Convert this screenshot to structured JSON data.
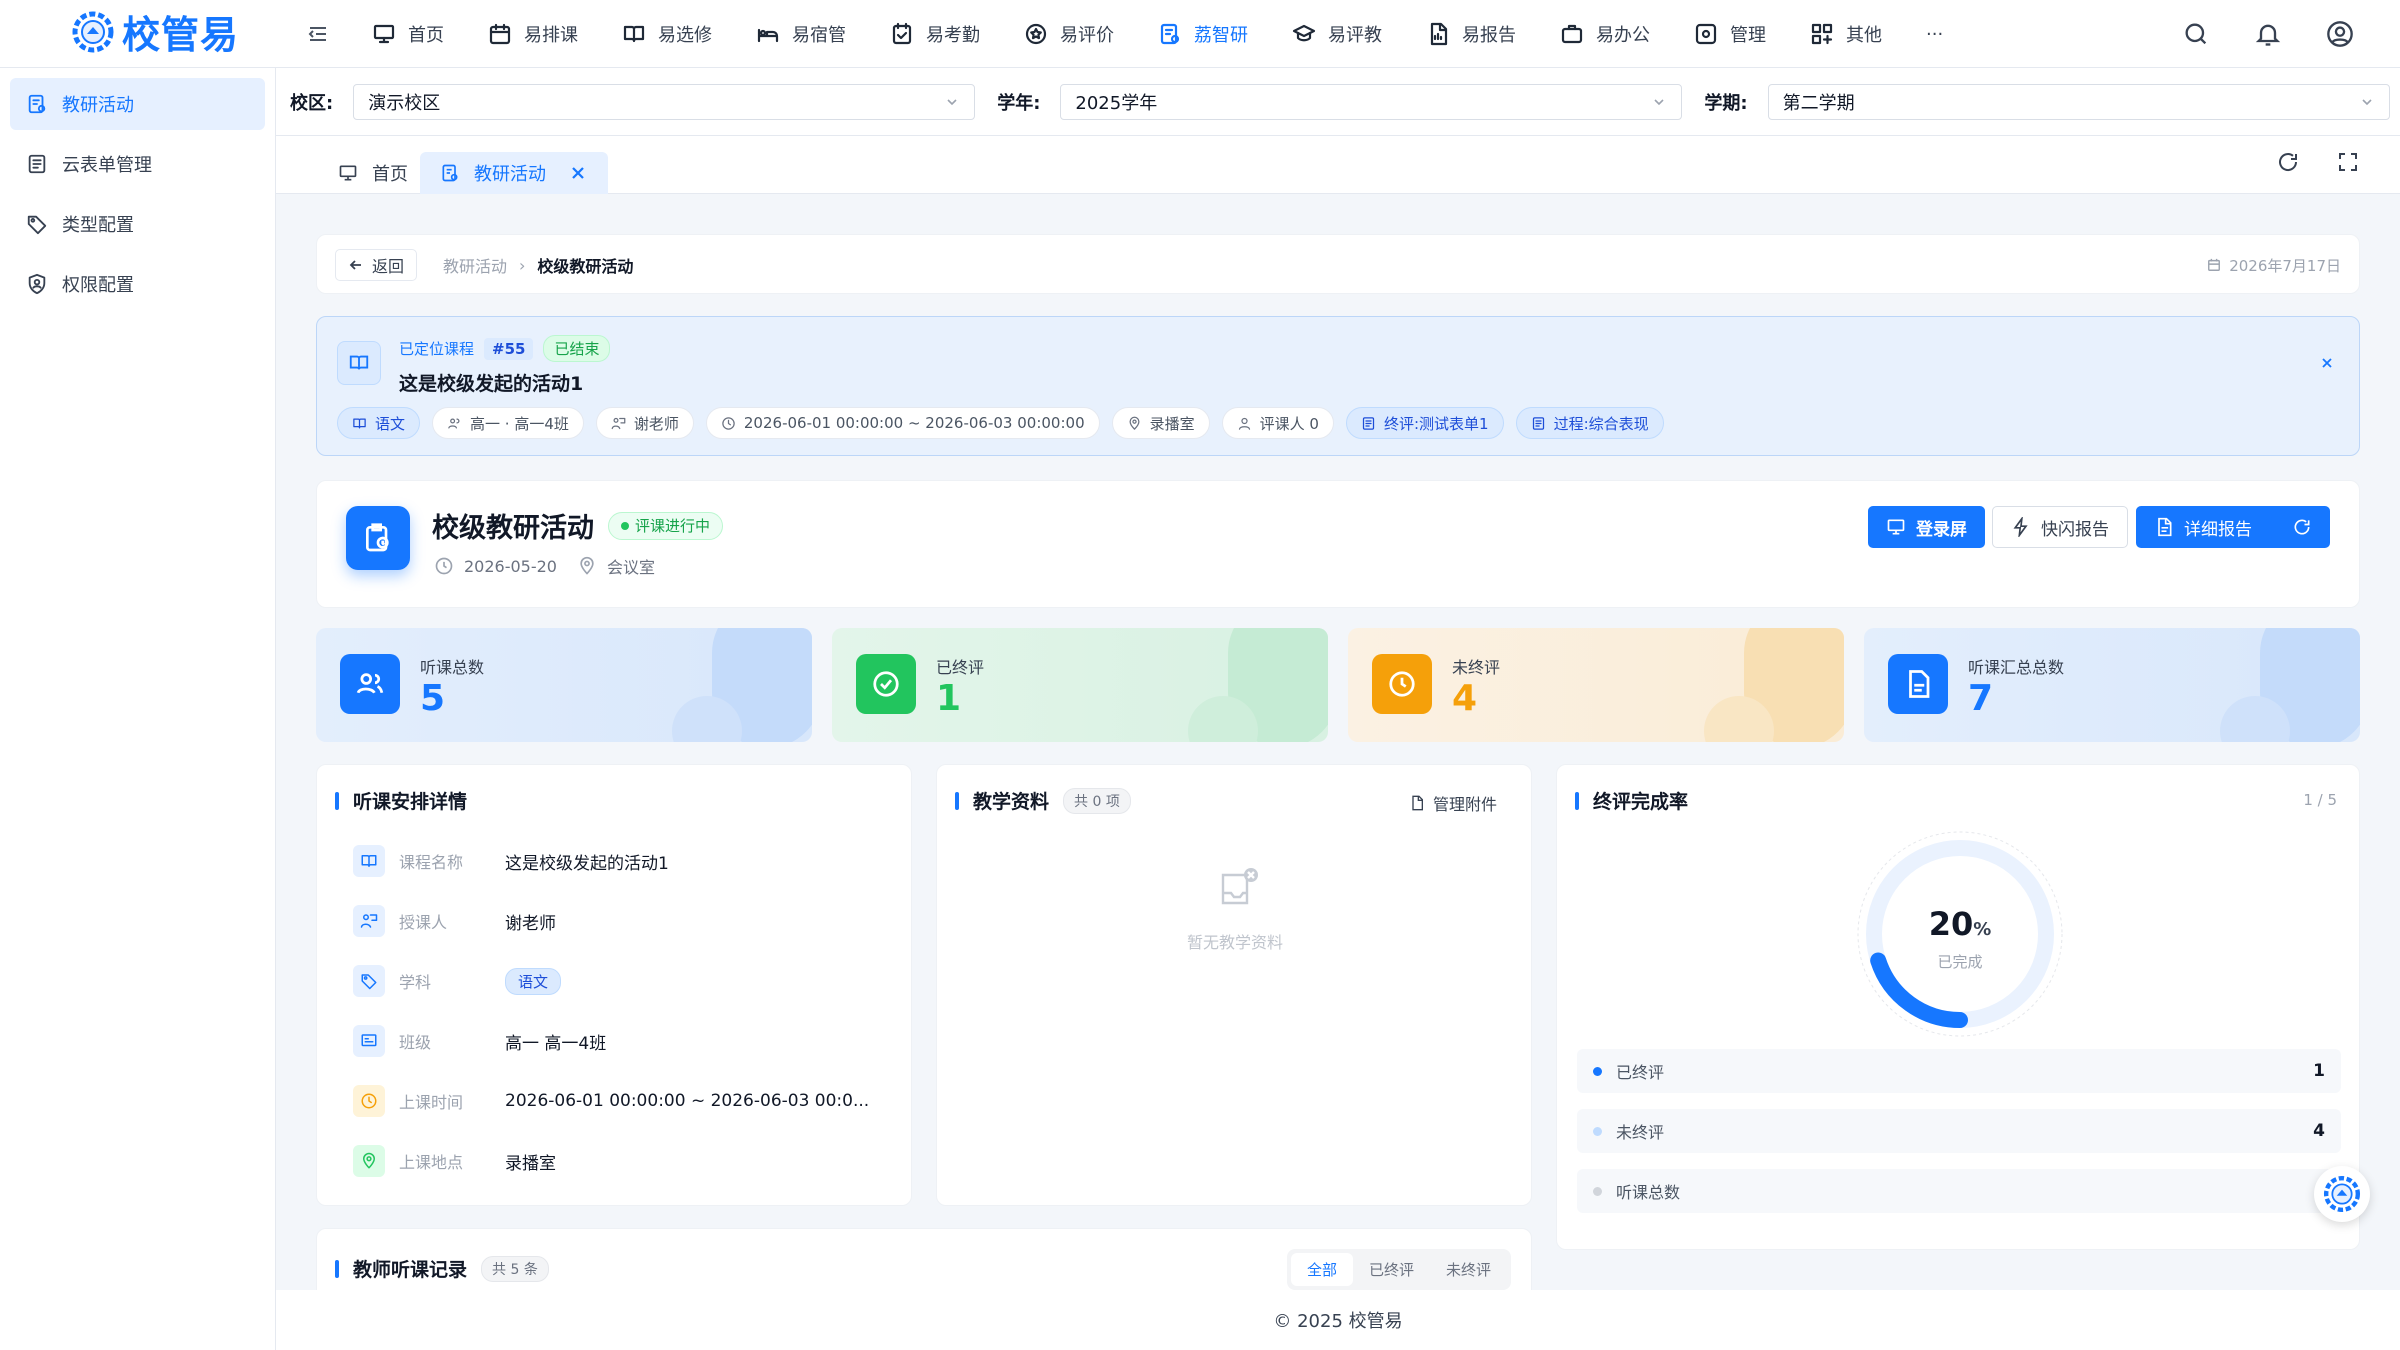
{
  "brand": {
    "name": "校管易",
    "color": "#1677ff"
  },
  "nav": [
    {
      "label": "首页",
      "icon": "monitor-icon"
    },
    {
      "label": "易排课",
      "icon": "calendar-icon"
    },
    {
      "label": "易选修",
      "icon": "book-icon"
    },
    {
      "label": "易宿管",
      "icon": "bed-icon"
    },
    {
      "label": "易考勤",
      "icon": "checklist-icon"
    },
    {
      "label": "易评价",
      "icon": "star-badge-icon"
    },
    {
      "label": "荔智研",
      "icon": "research-icon",
      "active": true
    },
    {
      "label": "易评教",
      "icon": "graduation-cap-icon"
    },
    {
      "label": "易报告",
      "icon": "report-icon"
    },
    {
      "label": "易办公",
      "icon": "briefcase-icon"
    },
    {
      "label": "管理",
      "icon": "settings-box-icon"
    },
    {
      "label": "其他",
      "icon": "apps-icon"
    },
    {
      "label": "···",
      "icon": "more-icon"
    }
  ],
  "sidebar": {
    "items": [
      {
        "label": "教研活动",
        "icon": "research-icon",
        "active": true
      },
      {
        "label": "云表单管理",
        "icon": "form-icon"
      },
      {
        "label": "类型配置",
        "icon": "tag-icon"
      },
      {
        "label": "权限配置",
        "icon": "shield-user-icon"
      }
    ]
  },
  "filters": {
    "campus_label": "校区:",
    "campus_value": "演示校区",
    "year_label": "学年:",
    "year_value": "2025学年",
    "term_label": "学期:",
    "term_value": "第二学期"
  },
  "tabs": [
    {
      "label": "首页"
    },
    {
      "label": "教研活动",
      "active": true
    }
  ],
  "breadcrumb": {
    "back": "返回",
    "parent": "教研活动",
    "current": "校级教研活动",
    "date": "2026年7月17日"
  },
  "located_course": {
    "tag": "已定位课程",
    "id": "#55",
    "status": "已结束",
    "title": "这是校级发起的活动1",
    "chips": [
      {
        "text": "语文",
        "icon": "book-icon",
        "highlight": true
      },
      {
        "text": "高一 · 高一4班",
        "icon": "people-icon"
      },
      {
        "text": "谢老师",
        "icon": "teacher-icon"
      },
      {
        "text": "2026-06-01 00:00:00 ~ 2026-06-03 00:00:00",
        "icon": "clock-icon"
      },
      {
        "text": "录播室",
        "icon": "location-icon"
      },
      {
        "text": "评课人 0",
        "icon": "user-icon"
      },
      {
        "text": "终评:测试表单1",
        "icon": "form-icon",
        "highlight": true
      },
      {
        "text": "过程:综合表现",
        "icon": "form-icon",
        "highlight": true
      }
    ]
  },
  "activity": {
    "title": "校级教研活动",
    "status": "评课进行中",
    "date": "2026-05-20",
    "place": "会议室",
    "buttons": {
      "screen": "登录屏",
      "quick": "快闪报告",
      "detail": "详细报告"
    }
  },
  "stats": [
    {
      "label": "听课总数",
      "value": "5",
      "color": "#1677ff"
    },
    {
      "label": "已终评",
      "value": "1",
      "color": "#22c55e"
    },
    {
      "label": "未终评",
      "value": "4",
      "color": "#f5a00a"
    },
    {
      "label": "听课汇总总数",
      "value": "7",
      "color": "#1677ff"
    }
  ],
  "schedule": {
    "title": "听课安排详情",
    "rows": [
      {
        "label": "课程名称",
        "value": "这是校级发起的活动1",
        "icon": "book-icon"
      },
      {
        "label": "授课人",
        "value": "谢老师",
        "icon": "teacher-icon"
      },
      {
        "label": "学科",
        "value": "语文",
        "icon": "tag-icon"
      },
      {
        "label": "班级",
        "value": "高一 高一4班",
        "icon": "class-icon"
      },
      {
        "label": "上课时间",
        "value": "2026-06-01 00:00:00 ~ 2026-06-03 00:0...",
        "icon": "clock-icon"
      },
      {
        "label": "上课地点",
        "value": "录播室",
        "icon": "location-icon"
      }
    ]
  },
  "materials": {
    "title": "教学资料",
    "count": "共 0 项",
    "manage": "管理附件",
    "empty": "暂无教学资料"
  },
  "completion": {
    "title": "终评完成率",
    "pager": "1 / 5",
    "percent": 20,
    "percent_text": "20",
    "unit": "%",
    "sub": "已完成",
    "legend": [
      {
        "label": "已终评",
        "value": "1",
        "color": "#1677ff"
      },
      {
        "label": "未终评",
        "value": "4",
        "color": "#bfdbfe"
      },
      {
        "label": "听课总数",
        "value": "",
        "color": "#d1d5db"
      }
    ]
  },
  "records": {
    "title": "教师听课记录",
    "count": "共 5 条",
    "filters": [
      "全部",
      "已终评",
      "未终评"
    ]
  },
  "footer": "© 2025 校管易"
}
